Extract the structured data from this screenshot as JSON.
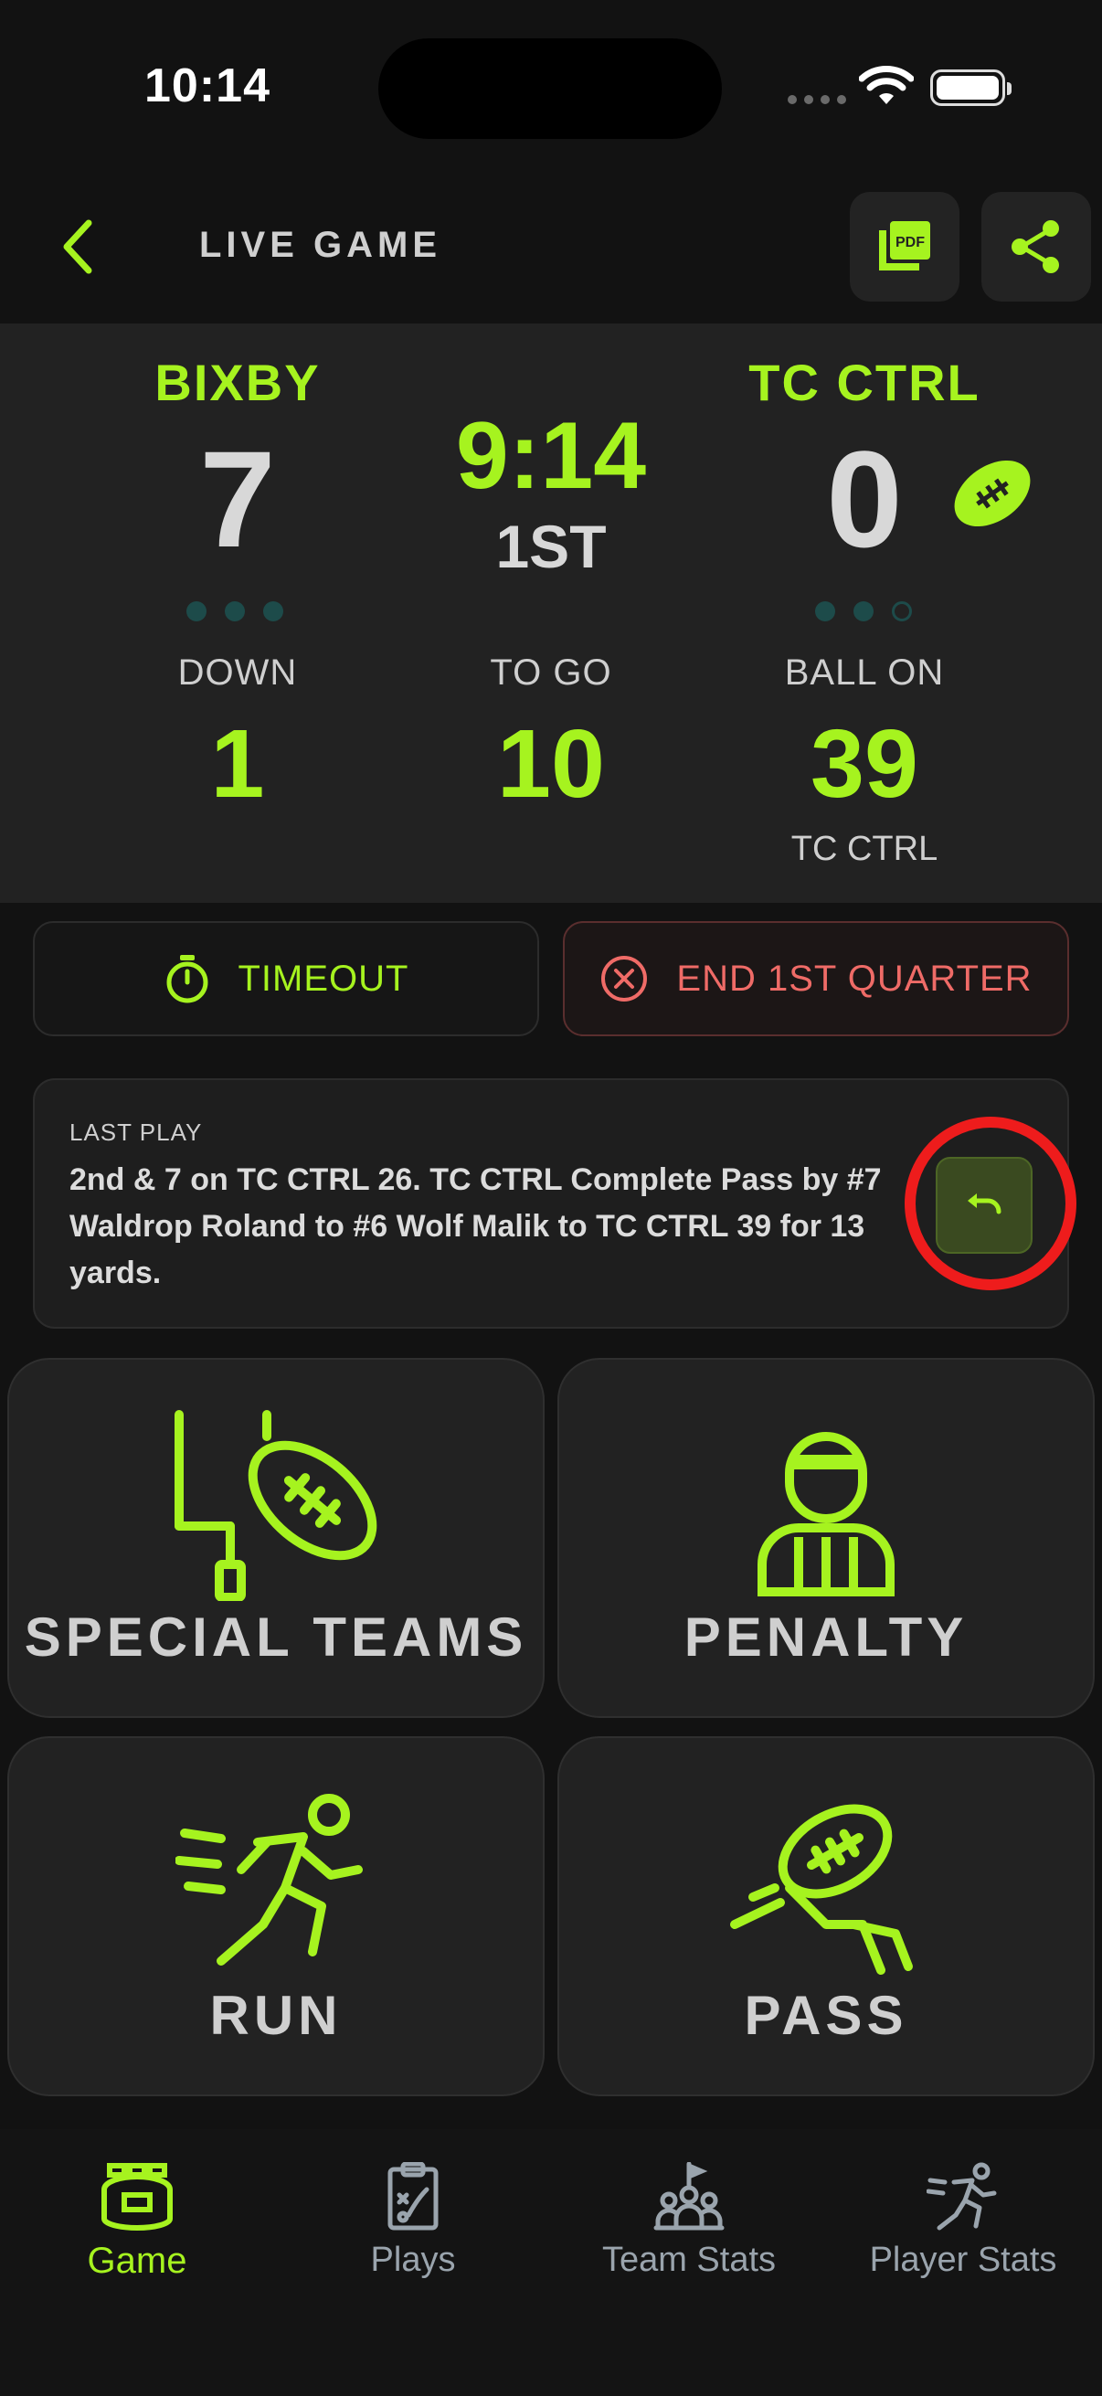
{
  "status_bar": {
    "time": "10:14"
  },
  "header": {
    "title": "LIVE GAME",
    "pdf_icon_text": "PDF"
  },
  "scoreboard": {
    "home": {
      "name": "BIXBY",
      "score": "7",
      "timeouts_remaining": 3
    },
    "away": {
      "name": "TC CTRL",
      "score": "0",
      "timeouts_remaining": 2,
      "has_possession": true
    },
    "clock": "9:14",
    "quarter": "1ST",
    "down_label": "DOWN",
    "down": "1",
    "to_go_label": "TO GO",
    "to_go": "10",
    "ball_on_label": "BALL ON",
    "ball_on": "39",
    "ball_on_team": "TC CTRL"
  },
  "actions": {
    "timeout_label": "TIMEOUT",
    "end_quarter_label": "END 1ST QUARTER"
  },
  "last_play": {
    "label": "LAST PLAY",
    "text": "2nd & 7 on TC CTRL 26. TC CTRL Complete Pass by #7 Waldrop Roland to #6 Wolf Malik to TC CTRL 39 for 13 yards."
  },
  "tiles": {
    "special_teams": "SPECIAL TEAMS",
    "penalty": "PENALTY",
    "run": "RUN",
    "pass": "PASS"
  },
  "nav": {
    "game": "Game",
    "plays": "Plays",
    "team_stats": "Team Stats",
    "player_stats": "Player Stats",
    "active": "Game"
  },
  "colors": {
    "accent": "#a6f31f",
    "danger": "#ef6b67",
    "background": "#121212",
    "panel": "#222222",
    "timeout_dot": "#1d4b4a",
    "highlight_ring": "#ee1c1c"
  }
}
